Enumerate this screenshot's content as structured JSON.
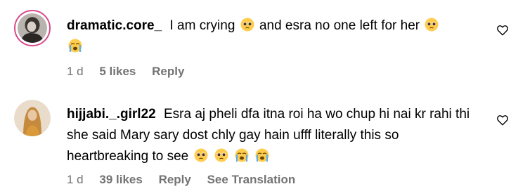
{
  "comments": [
    {
      "username": "dramatic.core_",
      "text_parts": [
        "I am crying",
        "and esra no one left for her"
      ],
      "emojis": [
        "pleading-face",
        "pleading-face",
        "loudly-crying-face"
      ],
      "time": "1 d",
      "likes": "5 likes",
      "reply": "Reply"
    },
    {
      "username": "hijjabi._.girl22",
      "text": "Esra aj pheli dfa itna roi ha wo chup hi nai kr rahi thi she said Mary sary dost chly gay hain ufff literally this so heartbreaking to see",
      "emojis": [
        "pleading-face",
        "pleading-face",
        "loudly-crying-face",
        "loudly-crying-face"
      ],
      "time": "1 d",
      "likes": "39 likes",
      "reply": "Reply",
      "see_translation": "See Translation"
    }
  ],
  "colors": {
    "text": "#000000",
    "meta": "#737373",
    "story_ring": "#d94b8b"
  }
}
